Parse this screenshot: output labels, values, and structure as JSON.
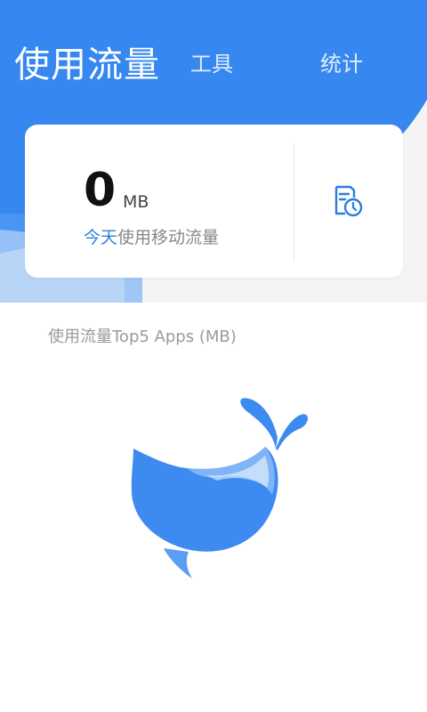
{
  "tabs": {
    "active_label": "使用流量",
    "tools_label": "工具",
    "stats_label": "统计"
  },
  "summary": {
    "value": "0",
    "unit": "MB",
    "today_label": "今天",
    "desc_label": "使用移动流量"
  },
  "section": {
    "title": "使用流量Top5 Apps (MB)"
  },
  "icons": {
    "history": "history-clock-icon",
    "empty_state": "whale-illustration"
  },
  "colors": {
    "primary": "#3385f0",
    "accent_text": "#2a7fdc",
    "background": "#f4f4f4"
  }
}
